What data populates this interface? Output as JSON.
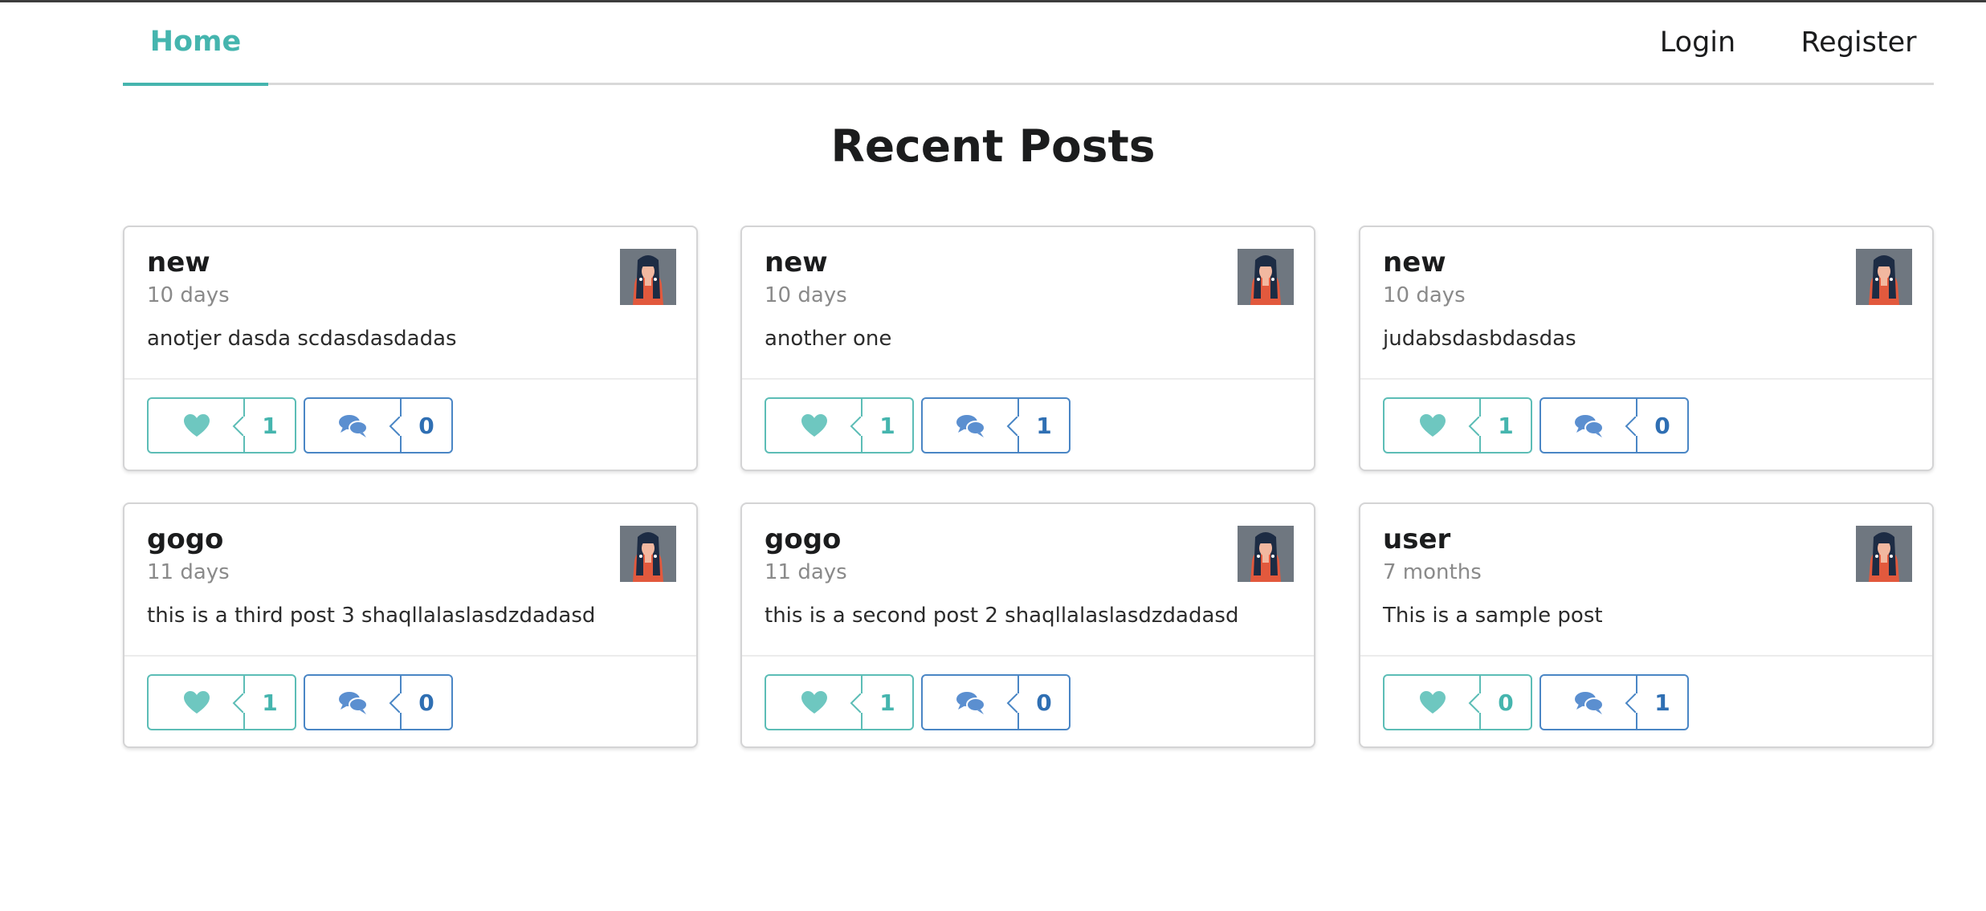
{
  "nav": {
    "home": "Home",
    "login": "Login",
    "register": "Register"
  },
  "page": {
    "title": "Recent Posts"
  },
  "colors": {
    "accent": "#45b5ae",
    "comment": "#2f6fb3"
  },
  "posts": [
    {
      "author": "new",
      "time": "10 days",
      "text": "anotjer dasda scdasdasdadas",
      "likes": "1",
      "comments": "0"
    },
    {
      "author": "new",
      "time": "10 days",
      "text": "another one",
      "likes": "1",
      "comments": "1"
    },
    {
      "author": "new",
      "time": "10 days",
      "text": "judabsdasbdasdas",
      "likes": "1",
      "comments": "0"
    },
    {
      "author": "gogo",
      "time": "11 days",
      "text": "this is a third post 3 shaqllalaslasdzdadasd",
      "likes": "1",
      "comments": "0"
    },
    {
      "author": "gogo",
      "time": "11 days",
      "text": "this is a second post 2 shaqllalaslasdzdadasd",
      "likes": "1",
      "comments": "0"
    },
    {
      "author": "user",
      "time": "7 months",
      "text": "This is a sample post",
      "likes": "0",
      "comments": "1"
    }
  ],
  "icons": {
    "like": "heart-icon",
    "comment": "comments-icon",
    "avatar": "avatar"
  }
}
